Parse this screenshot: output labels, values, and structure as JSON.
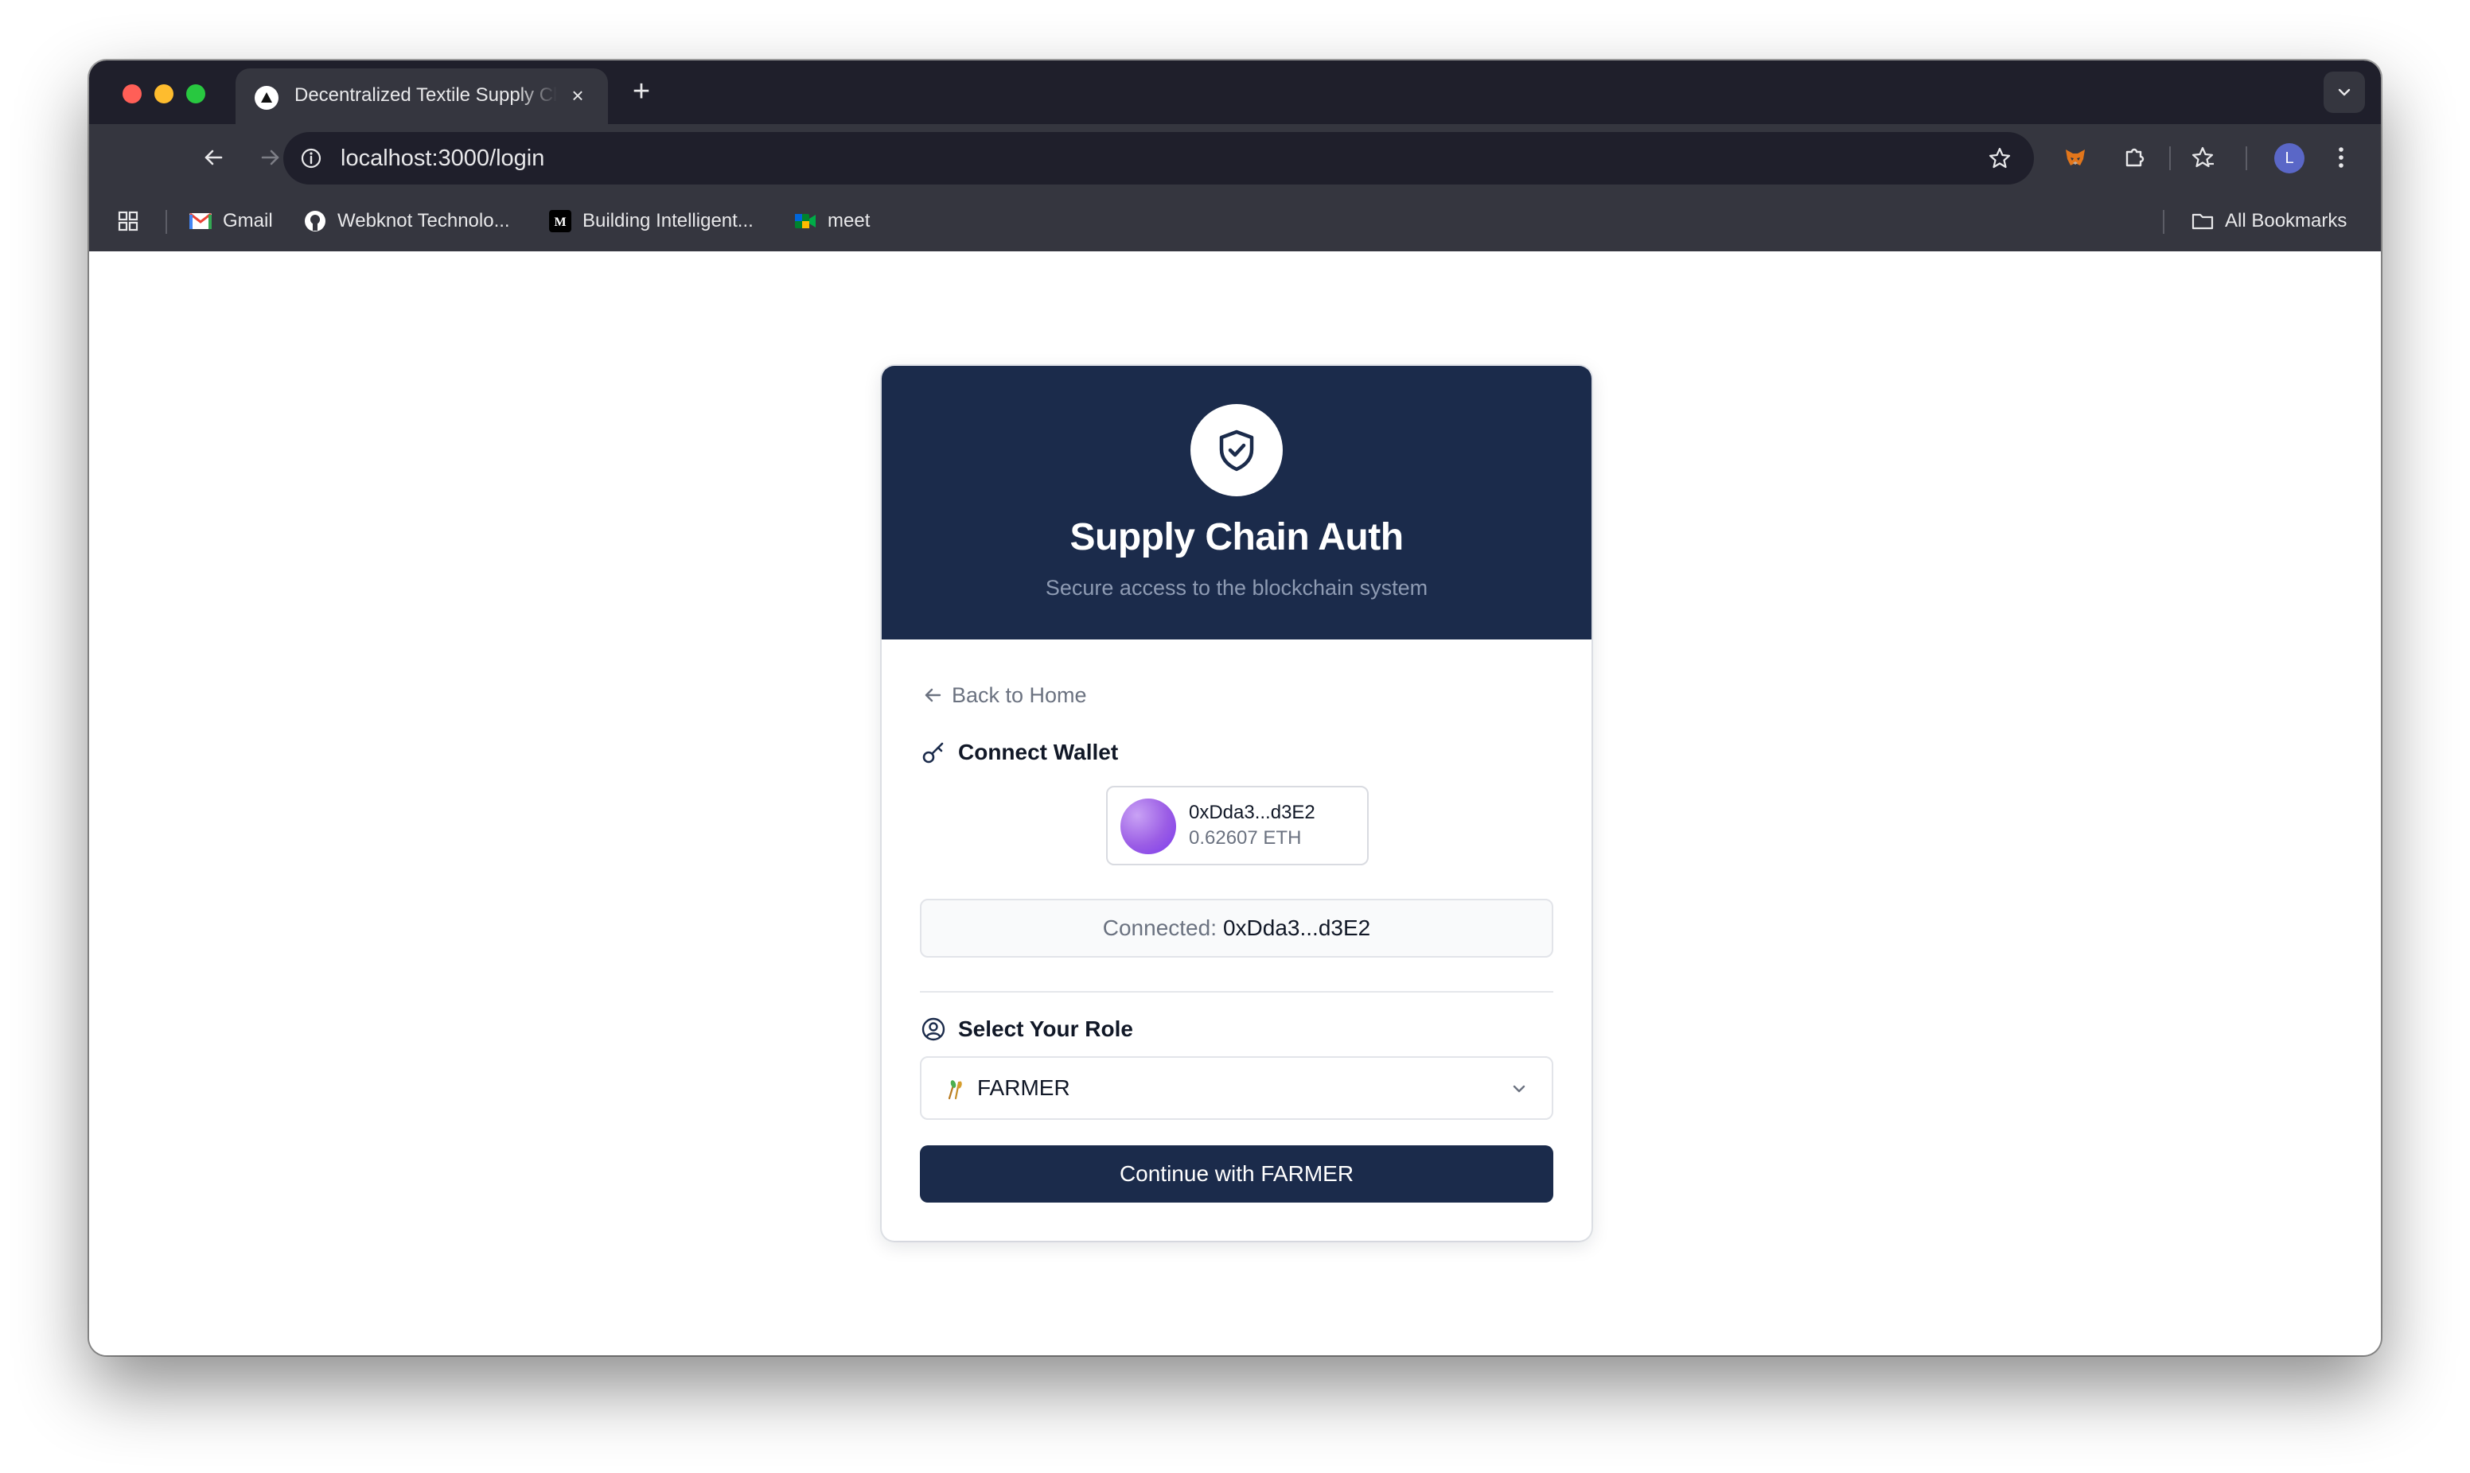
{
  "browser": {
    "tab": {
      "title": "Decentralized Textile Supply Chain",
      "close_glyph": "×"
    },
    "new_tab_glyph": "+",
    "url": "localhost:3000/login",
    "profile_initial": "L",
    "bookmarks": [
      {
        "label": "Gmail"
      },
      {
        "label": "Webknot Technolo..."
      },
      {
        "label": "Building Intelligent..."
      },
      {
        "label": "meet"
      }
    ],
    "all_bookmarks_label": "All Bookmarks"
  },
  "auth": {
    "title": "Supply Chain Auth",
    "subtitle": "Secure access to the blockchain system",
    "back_label": "Back to Home",
    "wallet_section_label": "Connect Wallet",
    "wallet": {
      "address": "0xDda3...d3E2",
      "balance": "0.62607 ETH"
    },
    "connected": {
      "label": "Connected:",
      "address": "0xDda3...d3E2"
    },
    "role_section_label": "Select Your Role",
    "role_select": {
      "selected": "FARMER"
    },
    "continue_label": "Continue with FARMER"
  },
  "colors": {
    "brand_navy": "#1b2b4b",
    "browser_frame": "#35363f",
    "browser_titlebar": "#1f1f2b",
    "wallet_avatar": "#9b5de5"
  }
}
